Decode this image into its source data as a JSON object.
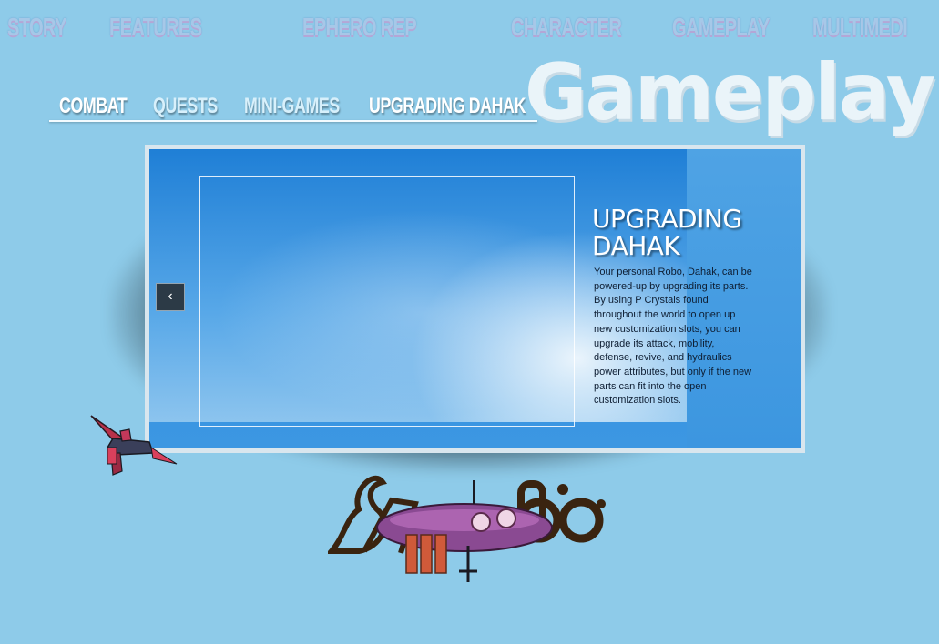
{
  "top_nav": [
    {
      "label": "STORY"
    },
    {
      "label": "FEATURES"
    },
    {
      "label": "EPHERO REP"
    },
    {
      "label": "CHARACTER"
    },
    {
      "label": "GAMEPLAY"
    },
    {
      "label": "MULTIMEDI"
    }
  ],
  "section_title": "Gameplay",
  "sub_nav": [
    {
      "label": "COMBAT"
    },
    {
      "label": "QUESTS"
    },
    {
      "label": "MINI-GAMES"
    },
    {
      "label": "UPGRADING  DAHAK"
    }
  ],
  "slide": {
    "heading_line1": "UPGRADING",
    "heading_line2": "DAHAK",
    "body": "Your personal Robo, Dahak, can be powered-up by upgrading its parts. By using P Crystals found throughout the world to open up new customization slots, you can upgrade its attack, mobility, defense, revive, and hydraulics power attributes, but only if the new parts can fit into the open customization slots."
  },
  "prev_button_glyph": "‹",
  "colors": {
    "background": "#8ecbe9",
    "nav_text": "#a6c8e8",
    "sub_nav_text": "#ffffff",
    "slide_blue": "#3c97e2"
  }
}
